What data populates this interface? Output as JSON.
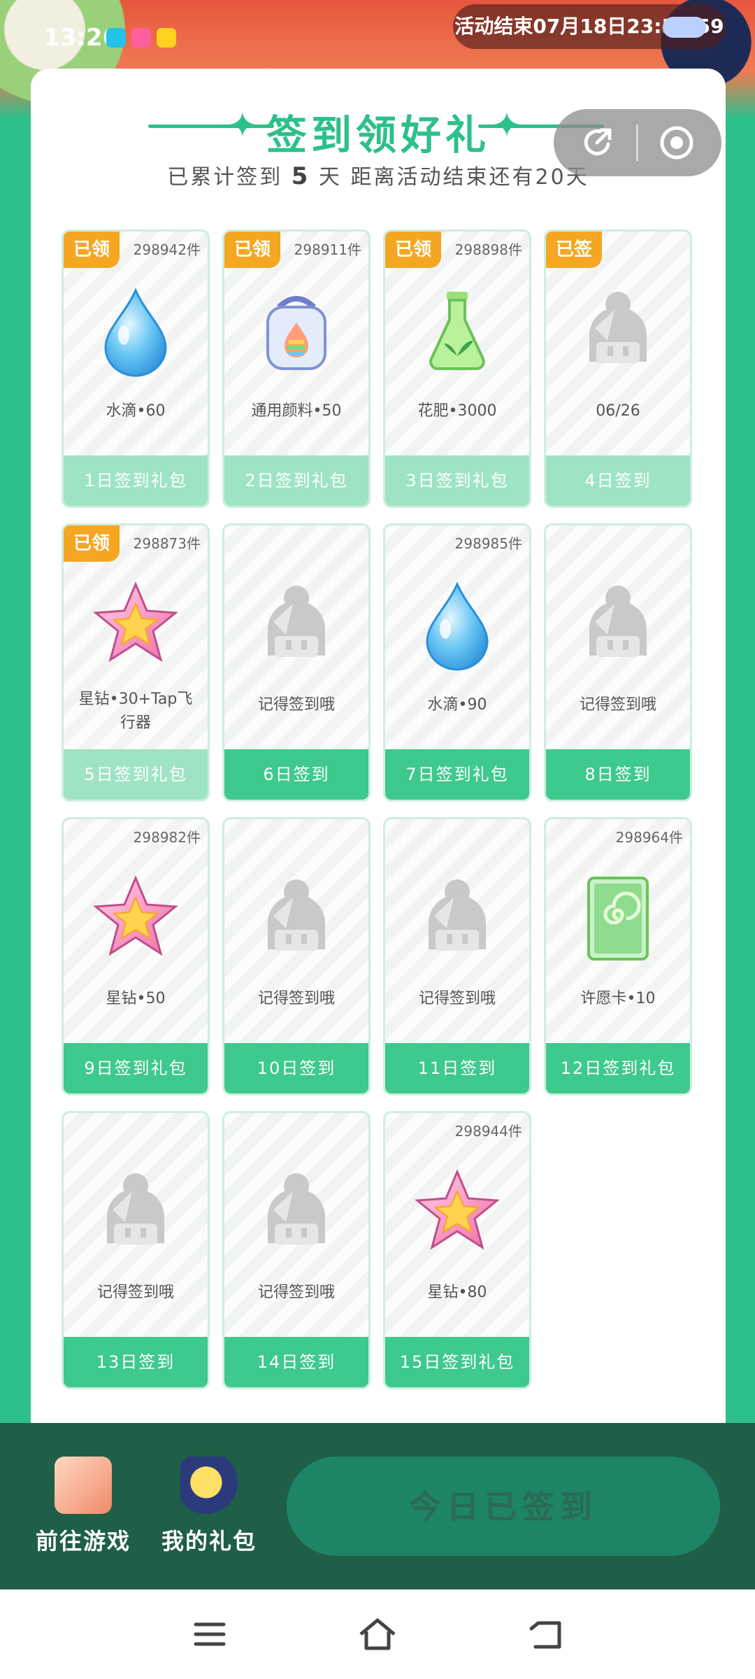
{
  "status_bar": {
    "time": "13:26"
  },
  "countdown": "活动结束07月18日23:59:59",
  "header": {
    "title": "签到领好礼",
    "subtitle_prefix": "已累计签到",
    "signed_days": "5",
    "subtitle_suffix": "天  距离活动结束还有20天"
  },
  "tiles": [
    {
      "badge": "已领",
      "count": "298942件",
      "label": "水滴•60",
      "footer": "1日签到礼包",
      "icon": "water-drop-icon",
      "done": true
    },
    {
      "badge": "已领",
      "count": "298911件",
      "label": "通用颜料•50",
      "footer": "2日签到礼包",
      "icon": "paint-jar-icon",
      "done": true
    },
    {
      "badge": "已领",
      "count": "298898件",
      "label": "花肥•3000",
      "footer": "3日签到礼包",
      "icon": "fertilizer-flask-icon",
      "done": true
    },
    {
      "badge": "已签",
      "count": "",
      "label": "06/26",
      "footer": "4日签到",
      "icon": "placeholder-character-icon",
      "done": true
    },
    {
      "badge": "已领",
      "count": "298873件",
      "label": "星钻•30+Tap飞行器",
      "footer": "5日签到礼包",
      "icon": "star-diamond-icon",
      "done": true
    },
    {
      "badge": "",
      "count": "",
      "label": "记得签到哦",
      "footer": "6日签到",
      "icon": "placeholder-character-icon",
      "done": false
    },
    {
      "badge": "",
      "count": "298985件",
      "label": "水滴•90",
      "footer": "7日签到礼包",
      "icon": "water-drop-icon",
      "done": false
    },
    {
      "badge": "",
      "count": "",
      "label": "记得签到哦",
      "footer": "8日签到",
      "icon": "placeholder-character-icon",
      "done": false
    },
    {
      "badge": "",
      "count": "298982件",
      "label": "星钻•50",
      "footer": "9日签到礼包",
      "icon": "star-diamond-icon",
      "done": false
    },
    {
      "badge": "",
      "count": "",
      "label": "记得签到哦",
      "footer": "10日签到",
      "icon": "placeholder-character-icon",
      "done": false
    },
    {
      "badge": "",
      "count": "",
      "label": "记得签到哦",
      "footer": "11日签到",
      "icon": "placeholder-character-icon",
      "done": false
    },
    {
      "badge": "",
      "count": "298964件",
      "label": "许愿卡•10",
      "footer": "12日签到礼包",
      "icon": "wish-card-icon",
      "done": false
    },
    {
      "badge": "",
      "count": "",
      "label": "记得签到哦",
      "footer": "13日签到",
      "icon": "placeholder-character-icon",
      "done": false
    },
    {
      "badge": "",
      "count": "",
      "label": "记得签到哦",
      "footer": "14日签到",
      "icon": "placeholder-character-icon",
      "done": false
    },
    {
      "badge": "",
      "count": "298944件",
      "label": "星钻•80",
      "footer": "15日签到礼包",
      "icon": "star-diamond-icon",
      "done": false
    }
  ],
  "bottom_bar": {
    "go_game": "前往游戏",
    "my_gifts": "我的礼包",
    "signin_button": "今日已签到"
  },
  "colors": {
    "accent": "#2cc08a",
    "badge": "#f5a623",
    "footer": "#3ec98d",
    "footer_done": "#9ee4c4"
  }
}
